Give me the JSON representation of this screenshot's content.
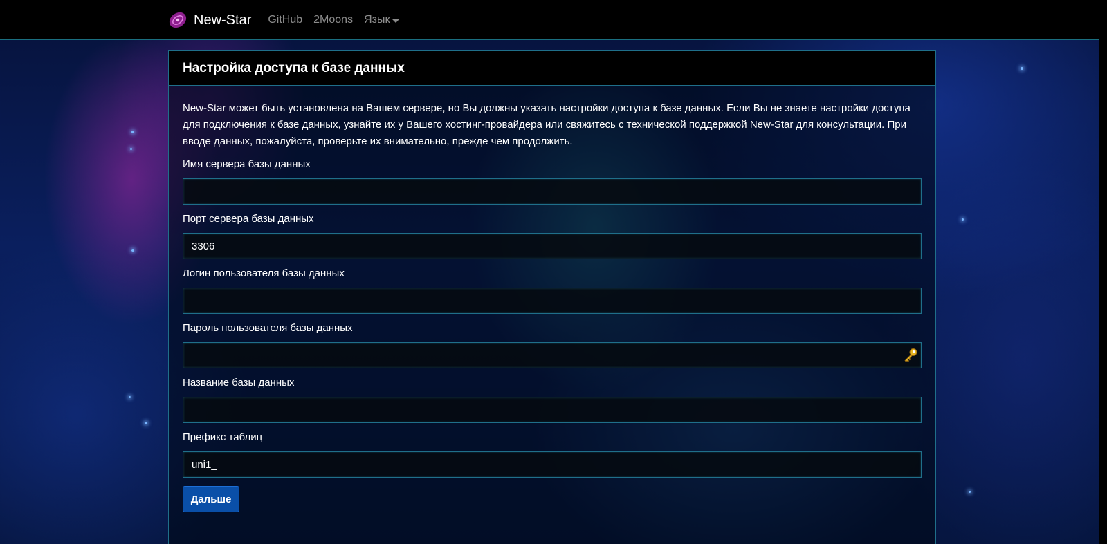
{
  "navbar": {
    "brand": "New-Star",
    "links": [
      {
        "label": "GitHub"
      },
      {
        "label": "2Moons"
      }
    ],
    "language_dropdown": "Язык"
  },
  "card": {
    "title": "Настройка доступа к базе данных",
    "intro": "New-Star может быть установлена на Вашем сервере, но Вы должны указать настройки доступа к базе данных. Если Вы не знаете настройки доступа для подключения к базе данных, узнайте их у Вашего хостинг-провайдера или свяжитесь с технической поддержкой New-Star для консультации. При вводе данных, пожалуйста, проверьте их внимательно, прежде чем продолжить.",
    "fields": {
      "host": {
        "label": "Имя сервера базы данных",
        "value": ""
      },
      "port": {
        "label": "Порт сервера базы данных",
        "value": "3306"
      },
      "user": {
        "label": "Логин пользователя базы данных",
        "value": ""
      },
      "password": {
        "label": "Пароль пользователя базы данных",
        "value": ""
      },
      "dbname": {
        "label": "Название базы данных",
        "value": ""
      },
      "prefix": {
        "label": "Префикс таблиц",
        "value": "uni1_"
      }
    },
    "next_button": "Дальше"
  },
  "icons": {
    "brand_logo": "galaxy-logo-icon",
    "password_manager": "key-icon"
  },
  "colors": {
    "navbar_bg": "#000000",
    "border_accent": "#1f6f8a",
    "button_primary": "#0a4fa8",
    "logo": "#8e1f8e",
    "key": "#e6b422"
  }
}
